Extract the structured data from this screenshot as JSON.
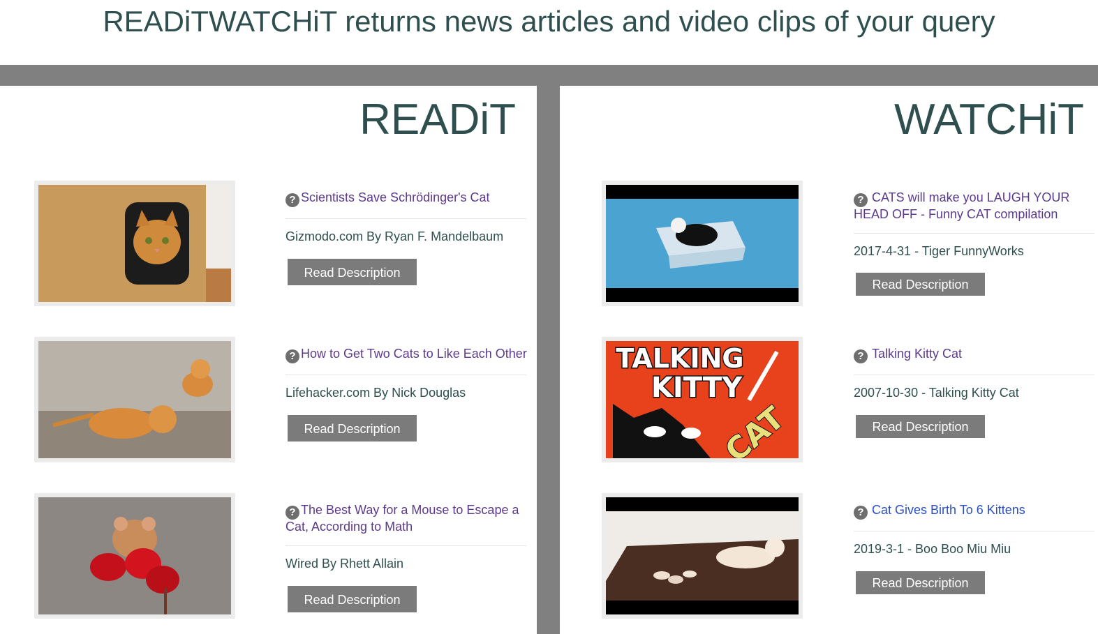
{
  "header": {
    "title": "READiTWATCHiT returns news articles and video clips of your query"
  },
  "readit": {
    "title": "READiT",
    "items": [
      {
        "title": "Scientists Save Schrödinger's Cat",
        "source": "Gizmodo.com By Ryan F. Mandelbaum",
        "button": "Read Description",
        "image": "cat-in-cardboard-box"
      },
      {
        "title": "How to Get Two Cats to Like Each Other",
        "source": "Lifehacker.com By Nick Douglas",
        "button": "Read Description",
        "image": "two-kittens-on-sand"
      },
      {
        "title": "The Best Way for a Mouse to Escape a Cat, According to Math",
        "source": "Wired By Rhett Allain",
        "button": "Read Description",
        "image": "mouse-on-red-berries"
      }
    ]
  },
  "watchit": {
    "title": "WATCHiT",
    "items": [
      {
        "title": "CATS will make you LAUGH YOUR HEAD OFF - Funny CAT compilation",
        "meta": "2017-4-31 - Tiger FunnyWorks",
        "button": "Read Description",
        "image": "cat-in-floating-box"
      },
      {
        "title": "Talking Kitty Cat",
        "meta": "2007-10-30 - Talking Kitty Cat",
        "button": "Read Description",
        "image": "talking-kitty-cat-logo",
        "logo_line1": "TALKING",
        "logo_line2": "KITTY",
        "logo_line3": "CAT"
      },
      {
        "title": "Cat Gives Birth To 6 Kittens",
        "meta": "2019-3-1 - Boo Boo Miu Miu",
        "button": "Read Description",
        "image": "cat-with-newborn-kittens"
      }
    ]
  },
  "colors": {
    "accent_text": "#2f4f4f",
    "bar": "#808080",
    "link_visited": "#5b3a8c",
    "link": "#2a50c9",
    "button": "#7b7b7b"
  },
  "icons": {
    "help": "question-mark-circle-icon"
  }
}
